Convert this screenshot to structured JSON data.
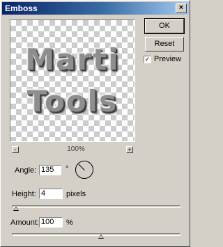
{
  "window": {
    "title": "Emboss",
    "close_glyph": "×"
  },
  "preview": {
    "line1": "Marti",
    "line2": "Tools",
    "zoom_level": "100%",
    "zoom_out_glyph": "-",
    "zoom_in_glyph": "+"
  },
  "buttons": {
    "ok": "OK",
    "reset": "Reset"
  },
  "preview_toggle": {
    "label": "Preview",
    "checked": true,
    "check_glyph": "✓"
  },
  "angle": {
    "label": "Angle:",
    "value": "135",
    "unit": "°"
  },
  "height": {
    "label": "Height:",
    "value": "4",
    "unit": "pixels",
    "slider_fraction": 0.02
  },
  "amount": {
    "label": "Amount:",
    "value": "100",
    "unit": "%",
    "slider_fraction": 0.53
  },
  "colors": {
    "dialog_bg": "#d4d0c8",
    "titlebar_start": "#0a246a",
    "titlebar_end": "#a6caf0"
  }
}
